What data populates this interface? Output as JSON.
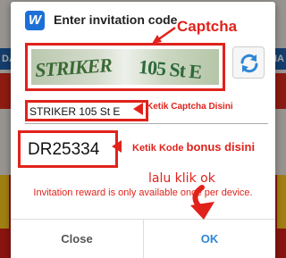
{
  "background": {
    "strip_left": "DAI",
    "strip_right": "MA"
  },
  "dialog": {
    "app_icon_letter": "W",
    "title": "Enter invitation code",
    "captcha_image_text_1": "STRIKER",
    "captcha_image_text_2": "105 St E",
    "captcha_input_value": "STRIKER 105 St E",
    "bonus_code_value": "DR25334",
    "reward_message": "Invitation reward is only available once per device.",
    "close_label": "Close",
    "ok_label": "OK"
  },
  "annotations": {
    "captcha": "Captcha",
    "ketik_captcha": "Ketik Captcha Disini",
    "ketik_kode_prefix": "Ketik Kode ",
    "ketik_kode_bold": "bonus disini",
    "lalu_klik_ok": "lalu klik ok"
  },
  "colors": {
    "accent_red": "#e0221b",
    "ok_blue": "#2f86d6",
    "app_icon_blue": "#1d6fd8"
  }
}
